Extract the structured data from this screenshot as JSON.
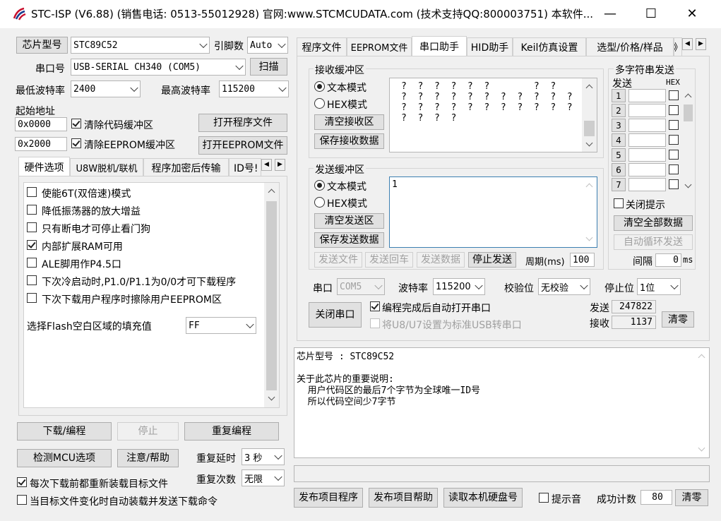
{
  "title": "STC-ISP (V6.88) (销售电话: 0513-55012928) 官网:www.STCMCUDATA.com  (技术支持QQ:800003751) 本软件...",
  "window_controls": {
    "minimize": "—",
    "maximize": "☐",
    "close": "✕"
  },
  "left": {
    "chip_label": "芯片型号",
    "chip_value": "STC89C52",
    "pins_label": "引脚数",
    "pins_value": "Auto",
    "port_label": "串口号",
    "port_value": "USB-SERIAL CH340 (COM5)",
    "scan_button": "扫描",
    "min_baud_label": "最低波特率",
    "min_baud_value": "2400",
    "max_baud_label": "最高波特率",
    "max_baud_value": "115200",
    "start_addr_label": "起始地址",
    "addr1": "0x0000",
    "clear_code_label": "清除代码缓冲区",
    "open_prog_button": "打开程序文件",
    "addr2": "0x2000",
    "clear_eeprom_label": "清除EEPROM缓冲区",
    "open_eeprom_button": "打开EEPROM文件",
    "tabs": [
      "硬件选项",
      "U8W脱机/联机",
      "程序加密后传输",
      "ID号!"
    ],
    "options": [
      {
        "label": "使能6T(双倍速)模式",
        "checked": false
      },
      {
        "label": "降低振荡器的放大增益",
        "checked": false
      },
      {
        "label": "只有断电才可停止看门狗",
        "checked": false
      },
      {
        "label": "内部扩展RAM可用",
        "checked": true
      },
      {
        "label": "ALE脚用作P4.5口",
        "checked": false
      },
      {
        "label": "下次冷启动时,P1.0/P1.1为0/0才可下载程序",
        "checked": false
      },
      {
        "label": "下次下载用户程序时擦除用户EEPROM区",
        "checked": false
      }
    ],
    "flash_fill_label": "选择Flash空白区域的填充值",
    "flash_fill_value": "FF",
    "download_button": "下载/编程",
    "stop_button": "停止",
    "reprogram_button": "重复编程",
    "check_mcu_button": "检测MCU选项",
    "help_button": "注意/帮助",
    "repeat_delay_label": "重复延时",
    "repeat_delay_value": "3 秒",
    "repeat_count_label": "重复次数",
    "repeat_count_value": "无限",
    "reload_label": "每次下载前都重新装载目标文件",
    "auto_send_label": "当目标文件变化时自动装载并发送下载命令"
  },
  "right": {
    "tabs": [
      "程序文件",
      "EEPROM文件",
      "串口助手",
      "HID助手",
      "Keil仿真设置",
      "选型/价格/样品",
      "》"
    ],
    "recv_group": "接收缓冲区",
    "recv_text_mode": "文本模式",
    "recv_hex_mode": "HEX模式",
    "clear_recv_button": "清空接收区",
    "save_recv_button": "保存接收数据",
    "recv_lines": [
      "?  ?  ?  ?  ?  ?        ?  ?",
      "?  ?  ?  ?  ?  ?  ?  ?  ?  ?  ?",
      "?  ?  ?  ?  ?  ?  ?  ?  ?  ?  ?",
      "?  ?  ?  ?"
    ],
    "send_group": "发送缓冲区",
    "send_text_mode": "文本模式",
    "send_hex_mode": "HEX模式",
    "clear_send_button": "清空发送区",
    "save_send_button": "保存发送数据",
    "send_value": "1",
    "send_file_button": "发送文件",
    "send_return_button": "发送回车",
    "send_data_button": "发送数据",
    "stop_send_button": "停止发送",
    "period_label": "周期(ms)",
    "period_value": "100",
    "multi_group": "多字符串发送",
    "multi_send_col": "发送",
    "multi_hex_col": "HEX",
    "multi_rows": [
      "1",
      "2",
      "3",
      "4",
      "5",
      "6",
      "7"
    ],
    "close_prompt_label": "关闭提示",
    "clear_all_button": "清空全部数据",
    "auto_loop_button": "自动循环发送",
    "interval_label": "间隔",
    "interval_value": "0",
    "interval_unit": "ms",
    "port_label": "串口",
    "port_value": "COM5",
    "baud_label": "波特率",
    "baud_value": "115200",
    "parity_label": "校验位",
    "parity_value": "无校验",
    "stop_bits_label": "停止位",
    "stop_bits_value": "1位",
    "close_port_button": "关闭串口",
    "auto_open_label": "编程完成后自动打开串口",
    "usb_label": "将U8/U7设置为标准USB转串口",
    "send_count_label": "发送",
    "send_count_value": "247822",
    "recv_count_label": "接收",
    "recv_count_value": "1137",
    "clear_count_button": "清零",
    "info_lines": [
      "芯片型号 : STC89C52",
      "",
      "关于此芯片的重要说明:",
      "  用户代码区的最后7个字节为全球唯一ID号",
      "  所以代码空间少7字节"
    ],
    "publish_prog_button": "发布项目程序",
    "publish_help_button": "发布项目帮助",
    "read_disk_button": "读取本机硬盘号",
    "sound_label": "提示音",
    "success_label": "成功计数",
    "success_value": "80",
    "clear_success_button": "清零"
  }
}
